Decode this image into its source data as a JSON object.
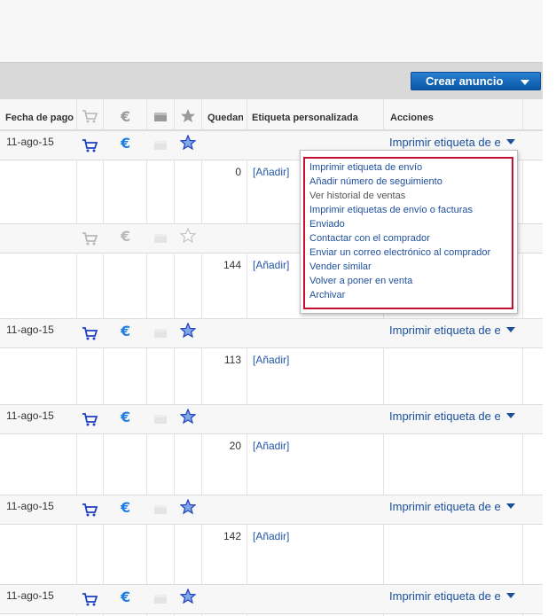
{
  "toolbar": {
    "create_label": "Crear anuncio"
  },
  "headers": {
    "payment_date": "Fecha de pago",
    "remaining": "Quedan",
    "custom_label": "Etiqueta personalizada",
    "actions": "Acciones"
  },
  "rows": [
    {
      "date": "11-ago-15",
      "remaining": "0",
      "add": "[Añadir]",
      "action": "Imprimir etiqueta de e",
      "icons_active": true
    },
    {
      "date": "",
      "remaining": "144",
      "add": "[Añadir]",
      "action": "",
      "icons_active": false
    },
    {
      "date": "11-ago-15",
      "remaining": "113",
      "add": "[Añadir]",
      "action": "Imprimir etiqueta de e",
      "icons_active": true
    },
    {
      "date": "11-ago-15",
      "remaining": "20",
      "add": "[Añadir]",
      "action": "Imprimir etiqueta de e",
      "icons_active": true
    },
    {
      "date": "11-ago-15",
      "remaining": "142",
      "add": "[Añadir]",
      "action": "Imprimir etiqueta de e",
      "icons_active": true
    },
    {
      "date": "11-ago-15",
      "remaining": "",
      "add": "",
      "action": "Imprimir etiqueta de e",
      "icons_active": true
    }
  ],
  "menu": {
    "items": [
      "Imprimir etiqueta de envío",
      "Añadir número de seguimiento",
      "Ver historial de ventas",
      "Imprimir etiquetas de envío o facturas",
      "Enviado",
      "Contactar con el comprador",
      "Enviar un correo electrónico al comprador",
      "Vender similar",
      "Volver a poner en venta",
      "Archivar"
    ]
  },
  "icons": {
    "cart": "shopping-cart-icon",
    "paid": "euro-icon",
    "shipped": "package-icon",
    "feedback": "star-icon"
  },
  "colors": {
    "link": "#1a4f9a",
    "accent": "#0a56a6",
    "menu_border": "#c8102e"
  }
}
